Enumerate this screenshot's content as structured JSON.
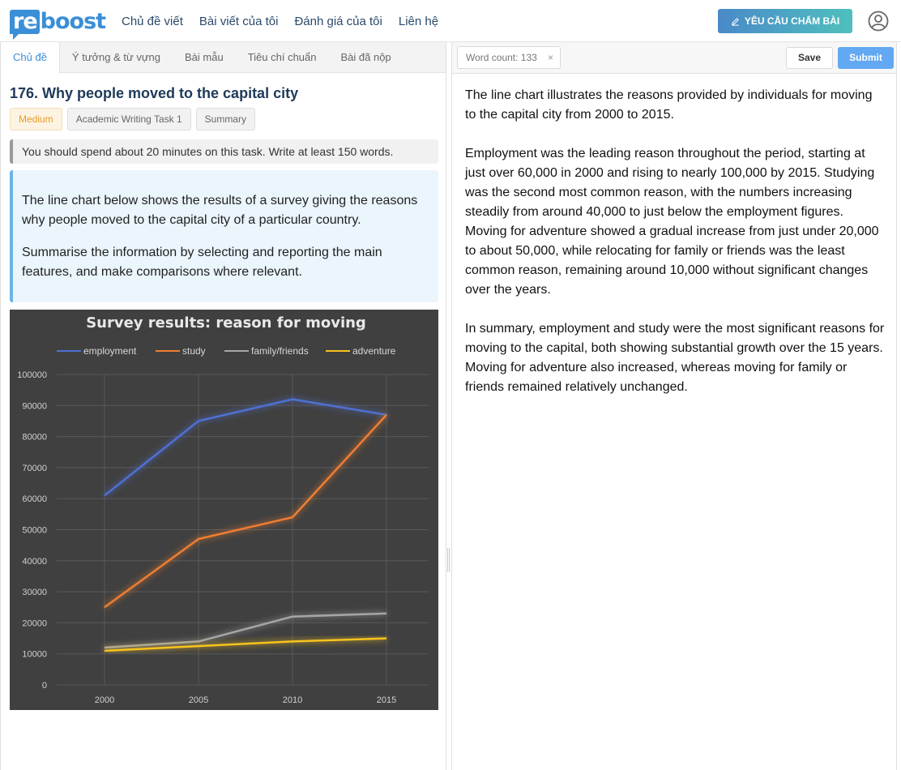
{
  "brand": {
    "logo_re": "re",
    "logo_boost": "boost"
  },
  "nav": [
    "Chủ đề viết",
    "Bài viết của tôi",
    "Đánh giá của tôi",
    "Liên hệ"
  ],
  "request_button": "YÊU CẦU CHẤM BÀI",
  "tabs": [
    "Chủ đề",
    "Ý tưởng & từ vựng",
    "Bài mẫu",
    "Tiêu chí chuẩn",
    "Bài đã nộp"
  ],
  "task": {
    "title": "176. Why people moved to the capital city",
    "tags": [
      "Medium",
      "Academic Writing Task 1",
      "Summary"
    ],
    "instruction": "You should spend about 20 minutes on this task. Write at least 150 words.",
    "prompt": [
      "The line chart below shows the results of a survey giving the reasons why people moved to the capital city of a particular country.",
      "Summarise the information by selecting and reporting the main features, and make comparisons where relevant."
    ]
  },
  "editor": {
    "word_count": "Word count: 133",
    "save_label": "Save",
    "submit_label": "Submit",
    "essay": [
      "The line chart illustrates the reasons provided by individuals for moving to the capital city from 2000 to 2015.",
      "Employment was the leading reason throughout the period, starting at just over 60,000 in 2000 and rising to nearly 100,000 by 2015. Studying was the second most common reason, with the numbers increasing steadily from around 40,000 to just below the employment figures. Moving for adventure showed a gradual increase from just under 20,000 to about 50,000, while relocating for family or friends was the least common reason, remaining around 10,000 without significant changes over the years.",
      "In summary, employment and study were the most significant reasons for moving to the capital, both showing substantial growth over the 15 years. Moving for adventure also increased, whereas moving for family or friends remained relatively unchanged."
    ]
  },
  "colors": {
    "accent": "#3a8fd6",
    "chart_bg": "#404040"
  },
  "chart_data": {
    "type": "line",
    "title": "Survey results: reason for moving",
    "x": [
      "2000",
      "2005",
      "2010",
      "2015"
    ],
    "ylim": [
      0,
      100000
    ],
    "yticks": [
      0,
      10000,
      20000,
      30000,
      40000,
      50000,
      60000,
      70000,
      80000,
      90000,
      100000
    ],
    "grid": true,
    "legend": "top",
    "series": [
      {
        "name": "employment",
        "color": "#4f6fd1",
        "values": [
          61000,
          85000,
          92000,
          87000
        ]
      },
      {
        "name": "study",
        "color": "#ee7e31",
        "values": [
          25000,
          47000,
          54000,
          87000
        ]
      },
      {
        "name": "family/friends",
        "color": "#a6a6a6",
        "values": [
          12000,
          14000,
          22000,
          23000
        ]
      },
      {
        "name": "adventure",
        "color": "#f8c31e",
        "values": [
          11000,
          12500,
          14000,
          15000
        ]
      }
    ]
  }
}
